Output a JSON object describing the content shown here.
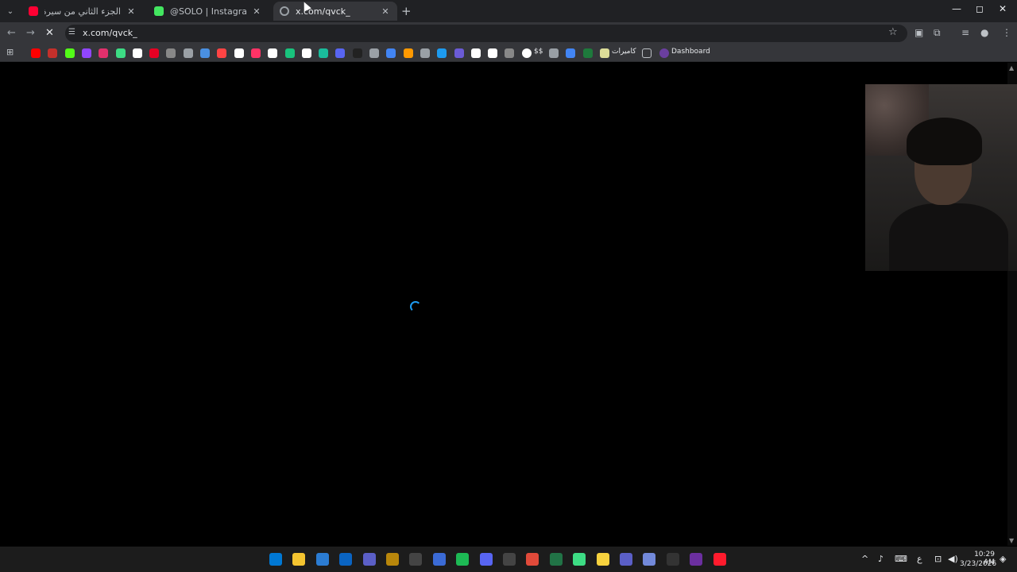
{
  "tabs": [
    {
      "title": "الجزء الثاني من سيرة الأنبياء | نايف...",
      "favicon_color": "#ff0033",
      "active": false
    },
    {
      "title": "@SOLO | Instagram, TikTok | Lin",
      "favicon_color": "#43e660",
      "active": false
    },
    {
      "title": "x.com/qvck_",
      "favicon_color": "#9aa0a6",
      "active": true
    }
  ],
  "omnibox": {
    "url": "x.com/qvck_"
  },
  "bookmarks": {
    "icon_colors": [
      "#ff0000",
      "#c4302b",
      "#53fc18",
      "#9146ff",
      "#e1306c",
      "#3ddc84",
      "#ffffff",
      "#e60023",
      "#888888",
      "#9aa0a6",
      "#4a90e2",
      "#ff4444",
      "#ffffff",
      "#ff3366",
      "#ffffff",
      "#19c37d",
      "#ffffff",
      "#1abc9c",
      "#5865f2",
      "#222222",
      "#9aa0a6",
      "#4285f4",
      "#ff9900",
      "#9aa0a6",
      "#1d9bf0",
      "#6b5bd6",
      "#ffffff",
      "#ffffff",
      "#888888"
    ],
    "g_label": "$$",
    "cameras_label": "كاميرات",
    "dashboard_label": "Dashboard"
  },
  "colors": {
    "accent": "#1d9bf0",
    "chrome_dark": "#202124",
    "chrome_mid": "#35363a"
  },
  "taskbar": {
    "apps": [
      "windows-start",
      "file-explorer",
      "notepad",
      "mail",
      "copilot",
      "winrar",
      "4k-downloader",
      "shield",
      "spotify",
      "discord",
      "obs",
      "chrome",
      "excel",
      "teams",
      "sticky-notes",
      "settings",
      "discord-2",
      "winamp",
      "game",
      "opera"
    ],
    "time": "10:29 AM",
    "date": "3/23/2026",
    "lang": "ع"
  }
}
